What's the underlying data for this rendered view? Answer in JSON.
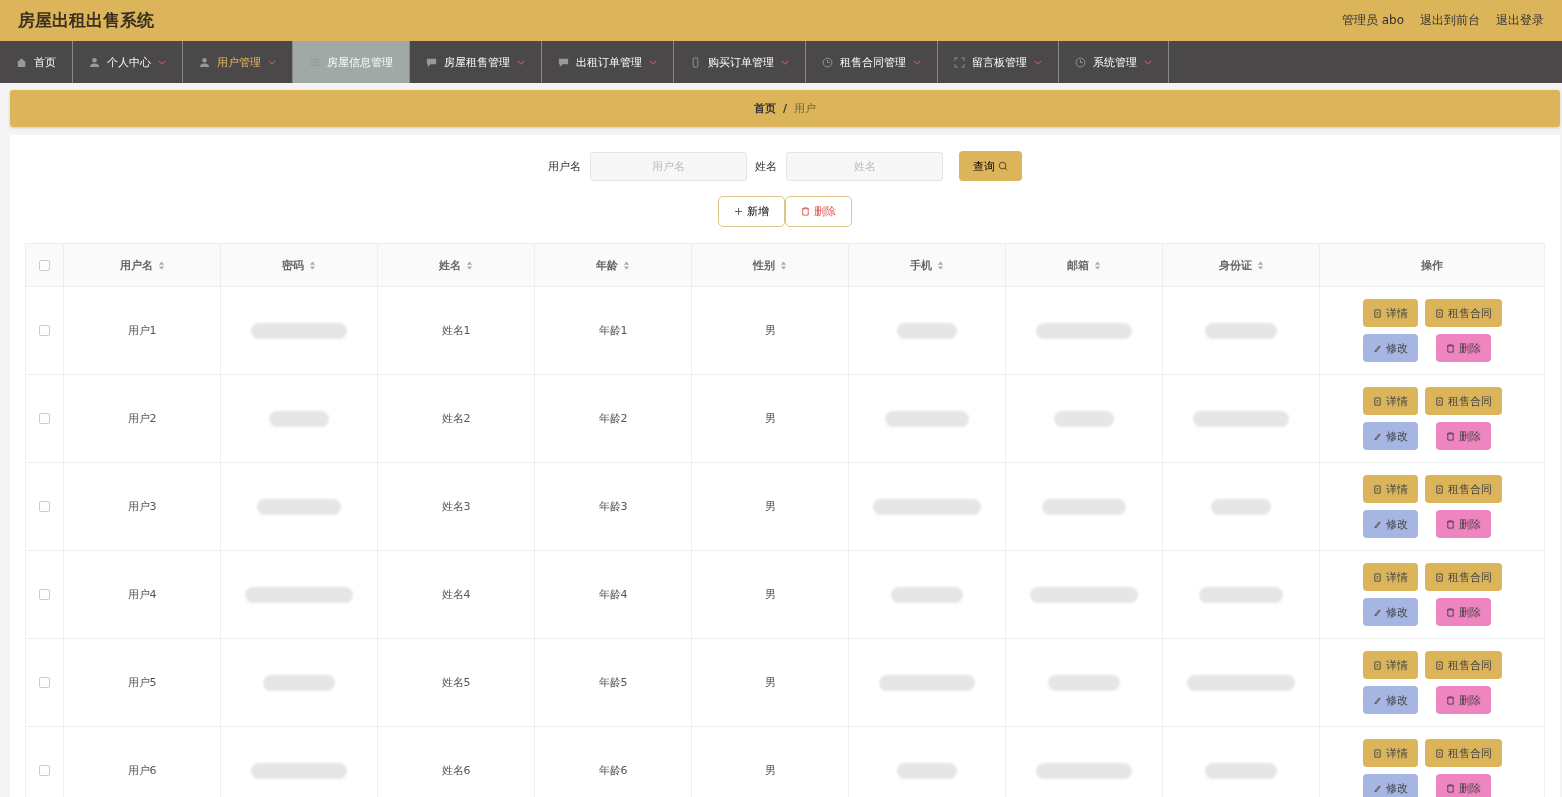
{
  "header": {
    "title": "房屋出租出售系统",
    "user": "管理员 abo",
    "links": [
      "退出到前台",
      "退出登录"
    ]
  },
  "nav": [
    {
      "label": "首页",
      "kind": "home",
      "dropdown": false,
      "selected": false,
      "hovered": false
    },
    {
      "label": "个人中心",
      "kind": "person",
      "dropdown": true,
      "selected": false,
      "hovered": false
    },
    {
      "label": "用户管理",
      "kind": "person",
      "dropdown": true,
      "selected": true,
      "hovered": false
    },
    {
      "label": "房屋信息管理",
      "kind": "list",
      "dropdown": false,
      "selected": false,
      "hovered": true
    },
    {
      "label": "房屋租售管理",
      "kind": "chat",
      "dropdown": true,
      "selected": false,
      "hovered": false
    },
    {
      "label": "出租订单管理",
      "kind": "chat",
      "dropdown": true,
      "selected": false,
      "hovered": false
    },
    {
      "label": "购买订单管理",
      "kind": "phone",
      "dropdown": true,
      "selected": false,
      "hovered": false
    },
    {
      "label": "租售合同管理",
      "kind": "clock",
      "dropdown": true,
      "selected": false,
      "hovered": false
    },
    {
      "label": "留言板管理",
      "kind": "frame",
      "dropdown": true,
      "selected": false,
      "hovered": false
    },
    {
      "label": "系统管理",
      "kind": "clock",
      "dropdown": true,
      "selected": false,
      "hovered": false
    }
  ],
  "breadcrumb": {
    "home": "首页",
    "separator": "/",
    "current": "用户"
  },
  "search": {
    "fields": [
      {
        "label": "用户名",
        "placeholder": "用户名"
      },
      {
        "label": "姓名",
        "placeholder": "姓名"
      }
    ],
    "button": "查询"
  },
  "actions": [
    {
      "label": "新增",
      "kind": "add"
    },
    {
      "label": "删除",
      "kind": "delete"
    }
  ],
  "table": {
    "select_all_checked": false,
    "columns": [
      {
        "label": "用户名",
        "blurred": false
      },
      {
        "label": "密码",
        "blurred": true
      },
      {
        "label": "姓名",
        "blurred": false
      },
      {
        "label": "年龄",
        "blurred": false
      },
      {
        "label": "性别",
        "blurred": false
      },
      {
        "label": "手机",
        "blurred": true
      },
      {
        "label": "邮箱",
        "blurred": true
      },
      {
        "label": "身份证",
        "blurred": true
      }
    ],
    "action_column": "操作",
    "rows": [
      {
        "checked": false,
        "cells": [
          "用户1",
          "",
          "姓名1",
          "年龄1",
          "男",
          "",
          "",
          ""
        ],
        "buttons": [
          {
            "label": "详情",
            "kind": "detail"
          },
          {
            "label": "租售合同",
            "kind": "detail"
          },
          {
            "label": "修改",
            "kind": "edit"
          },
          {
            "label": "删除",
            "kind": "delete"
          }
        ]
      },
      {
        "checked": false,
        "cells": [
          "用户2",
          "",
          "姓名2",
          "年龄2",
          "男",
          "",
          "",
          ""
        ],
        "buttons": [
          {
            "label": "详情",
            "kind": "detail"
          },
          {
            "label": "租售合同",
            "kind": "detail"
          },
          {
            "label": "修改",
            "kind": "edit"
          },
          {
            "label": "删除",
            "kind": "delete"
          }
        ]
      },
      {
        "checked": false,
        "cells": [
          "用户3",
          "",
          "姓名3",
          "年龄3",
          "男",
          "",
          "",
          ""
        ],
        "buttons": [
          {
            "label": "详情",
            "kind": "detail"
          },
          {
            "label": "租售合同",
            "kind": "detail"
          },
          {
            "label": "修改",
            "kind": "edit"
          },
          {
            "label": "删除",
            "kind": "delete"
          }
        ]
      },
      {
        "checked": false,
        "cells": [
          "用户4",
          "",
          "姓名4",
          "年龄4",
          "男",
          "",
          "",
          ""
        ],
        "buttons": [
          {
            "label": "详情",
            "kind": "detail"
          },
          {
            "label": "租售合同",
            "kind": "detail"
          },
          {
            "label": "修改",
            "kind": "edit"
          },
          {
            "label": "删除",
            "kind": "delete"
          }
        ]
      },
      {
        "checked": false,
        "cells": [
          "用户5",
          "",
          "姓名5",
          "年龄5",
          "男",
          "",
          "",
          ""
        ],
        "buttons": [
          {
            "label": "详情",
            "kind": "detail"
          },
          {
            "label": "租售合同",
            "kind": "detail"
          },
          {
            "label": "修改",
            "kind": "edit"
          },
          {
            "label": "删除",
            "kind": "delete"
          }
        ]
      },
      {
        "checked": false,
        "cells": [
          "用户6",
          "",
          "姓名6",
          "年龄6",
          "男",
          "",
          "",
          ""
        ],
        "buttons": [
          {
            "label": "详情",
            "kind": "detail"
          },
          {
            "label": "租售合同",
            "kind": "detail"
          },
          {
            "label": "修改",
            "kind": "edit"
          },
          {
            "label": "删除",
            "kind": "delete"
          }
        ]
      }
    ]
  }
}
